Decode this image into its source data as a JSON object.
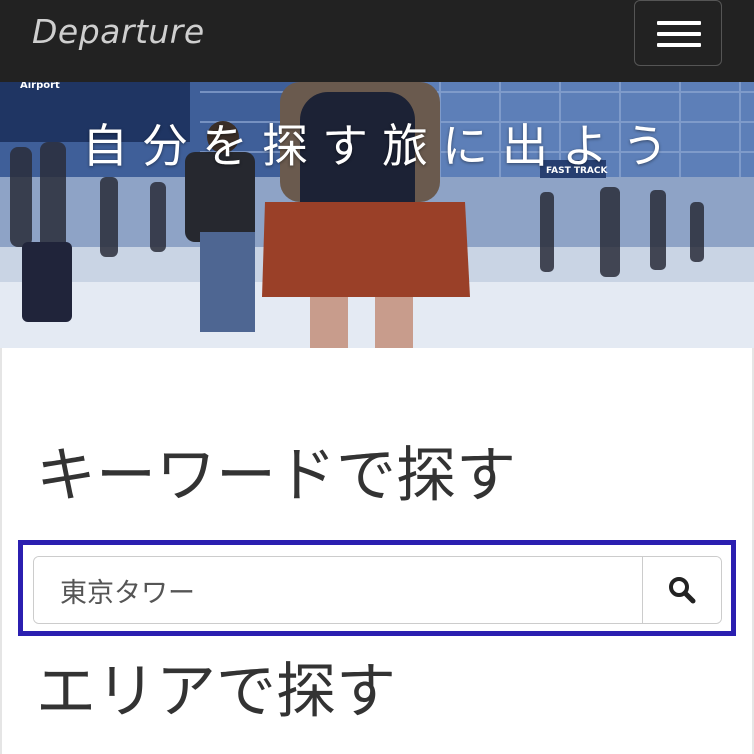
{
  "navbar": {
    "brand": "Departure",
    "menu_icon": "hamburger-menu-icon"
  },
  "hero": {
    "title": "自分を探す旅に出よう",
    "image": "airport-traveler-photo",
    "signs": {
      "airport": "Airport",
      "fast_track": "FAST TRACK"
    }
  },
  "keyword_section": {
    "title": "キーワードで探す",
    "search_value": "東京タワー",
    "search_icon": "search-icon",
    "highlight_color": "#2b1fb0"
  },
  "area_section": {
    "title": "エリアで探す"
  }
}
